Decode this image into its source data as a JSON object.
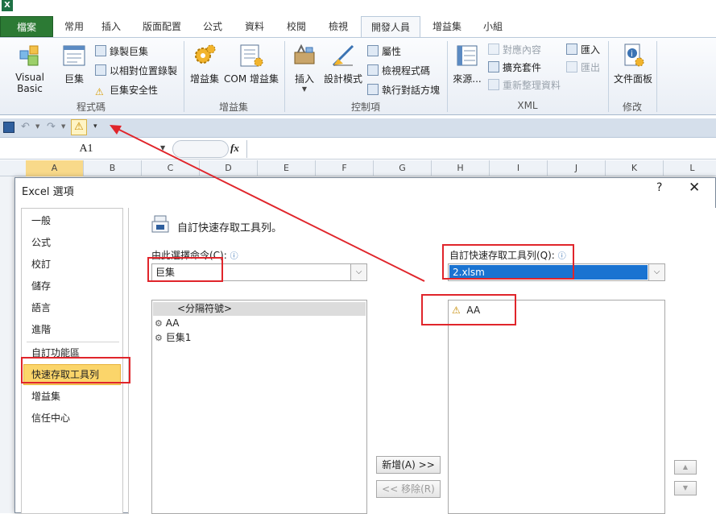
{
  "app": {
    "logo": "X"
  },
  "tabs": [
    {
      "label": "檔案"
    },
    {
      "label": "常用"
    },
    {
      "label": "插入"
    },
    {
      "label": "版面配置"
    },
    {
      "label": "公式"
    },
    {
      "label": "資料"
    },
    {
      "label": "校閱"
    },
    {
      "label": "檢視"
    },
    {
      "label": "開發人員"
    },
    {
      "label": "增益集"
    },
    {
      "label": "小組"
    }
  ],
  "ribbon": {
    "code": {
      "label": "程式碼",
      "visual_basic": "Visual Basic",
      "macros": "巨集",
      "record_macro": "錄製巨集",
      "relative_refs": "以相對位置錄製",
      "macro_security": "巨集安全性"
    },
    "addins": {
      "label": "增益集",
      "addins_btn": "增益集",
      "com_addins": "COM 增益集"
    },
    "controls": {
      "label": "控制項",
      "insert": "插入",
      "design_mode": "設計模式",
      "properties": "屬性",
      "view_code": "檢視程式碼",
      "run_dialog": "執行對話方塊"
    },
    "xml": {
      "label": "XML",
      "source": "來源...",
      "map_properties": "對應內容",
      "expansion_packs": "擴充套件",
      "refresh_data": "重新整理資料",
      "import": "匯入",
      "export": "匯出"
    },
    "modify": {
      "label": "修改",
      "document_panel": "文件面板"
    }
  },
  "formula_bar": {
    "name_box": "A1",
    "fx": "fx"
  },
  "columns": [
    "A",
    "B",
    "C",
    "D",
    "E",
    "F",
    "G",
    "H",
    "I",
    "J",
    "K",
    "L"
  ],
  "dialog": {
    "title": "Excel 選項",
    "help": "?",
    "close": "✕",
    "nav": [
      "一般",
      "公式",
      "校訂",
      "儲存",
      "語言",
      "進階",
      "自訂功能區",
      "快速存取工具列",
      "增益集",
      "信任中心"
    ],
    "heading": "自訂快速存取工具列。",
    "choose_label": "由此選擇命令(C):",
    "choose_value": "巨集",
    "customize_label": "自訂快速存取工具列(Q):",
    "customize_value": "2.xlsm",
    "left_list": [
      "<分隔符號>",
      "AA",
      "巨集1"
    ],
    "right_list": [
      "AA"
    ],
    "add_button": "新增(A) >>",
    "remove_button": "<< 移除(R)",
    "up_glyph": "▲",
    "down_glyph": "▼"
  }
}
